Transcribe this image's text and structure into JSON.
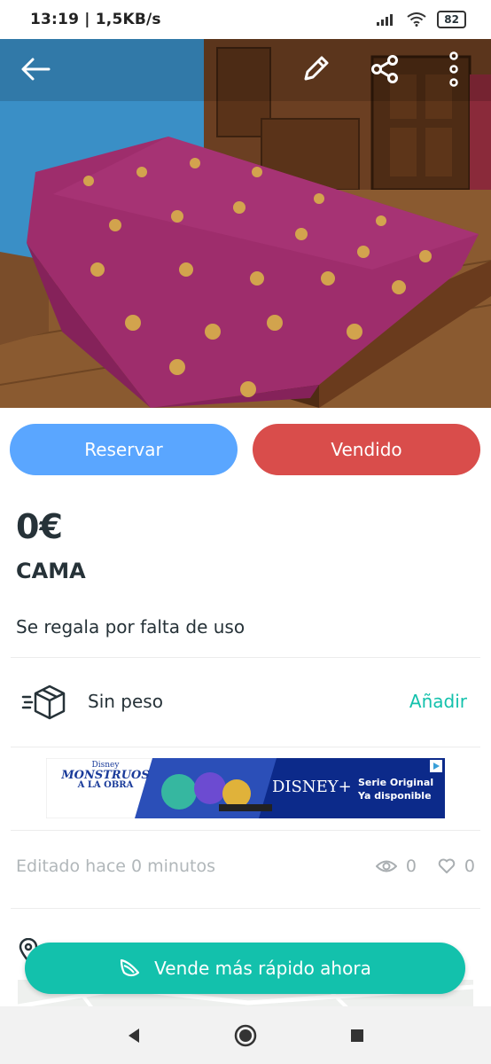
{
  "status_bar": {
    "time": "13:19 | 1,5KB/s",
    "battery": "82"
  },
  "photo": {
    "icons": [
      "back-arrow-icon",
      "edit-pencil-icon",
      "share-icon",
      "more-options-icon"
    ]
  },
  "actions": {
    "reserve_label": "Reservar",
    "sold_label": "Vendido"
  },
  "item": {
    "price": "0€",
    "title": "CAMA",
    "description": "Se regala por falta de uso"
  },
  "shipping": {
    "weight_label": "Sin peso",
    "add_label": "Añadir"
  },
  "ad": {
    "brand_small": "Disney",
    "title_line1": "MONSTRUOS",
    "title_line2": "A LA OBRA",
    "platform": "DISNEY+",
    "tagline_line1": "Serie Original",
    "tagline_line2": "Ya disponible"
  },
  "meta": {
    "edited": "Editado hace 0 minutos",
    "views": "0",
    "favorites": "0"
  },
  "cta": {
    "label": "Vende más rápido ahora"
  },
  "colors": {
    "reserve": "#5aa6ff",
    "sold": "#d94d4b",
    "accent": "#13c1ac",
    "text": "#263238"
  }
}
